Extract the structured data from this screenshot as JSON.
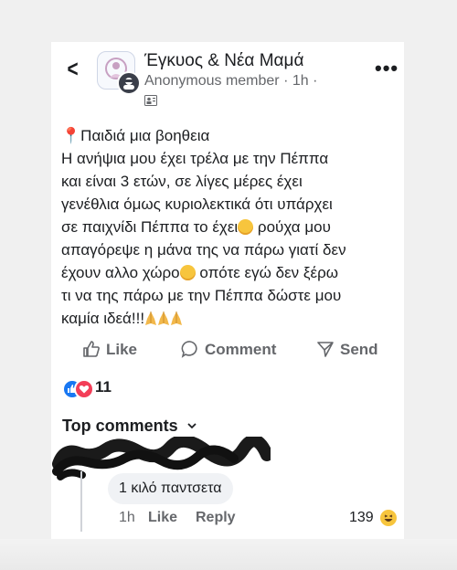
{
  "header": {
    "back_glyph": "<",
    "group_name": "Έγκυος & Νέα Μαμά",
    "author": "Anonymous member",
    "time": "1h",
    "more_glyph": "•••"
  },
  "post": {
    "pin": "📍",
    "line1": "Παιδιά μια βοηθεια",
    "line2": "Η ανήψια μου έχει τρέλα με την Πέππα",
    "line3": "και είναι 3 ετών, σε λίγες μέρες έχει",
    "line4": "γενέθλια όμως κυριολεκτικά ότι υπάρχει",
    "line5a": "σε παιχνίδι Πέππα το έχει",
    "line5b": " ρούχα μου",
    "line6": "απαγόρεψε η μάνα της να πάρω γιατί δεν",
    "line7a": "έχουν αλλο χώρο",
    "line7b": " οπότε εγώ δεν ξέρω",
    "line8": "τι να της πάρω με την Πέππα δώστε μου",
    "line9": "καμία ιδεά!!!"
  },
  "actions": {
    "like": "Like",
    "comment": "Comment",
    "send": "Send"
  },
  "reactions": {
    "count": "11"
  },
  "comments": {
    "section_title": "Top comments",
    "items": [
      {
        "text": "1 κιλό παντσετα",
        "time": "1h",
        "like": "Like",
        "reply": "Reply",
        "reaction_count": "139"
      }
    ]
  },
  "colors": {
    "text": "#1c1e21",
    "muted": "#65676b",
    "facebook_blue": "#1877f2",
    "love_red": "#f33e58"
  }
}
